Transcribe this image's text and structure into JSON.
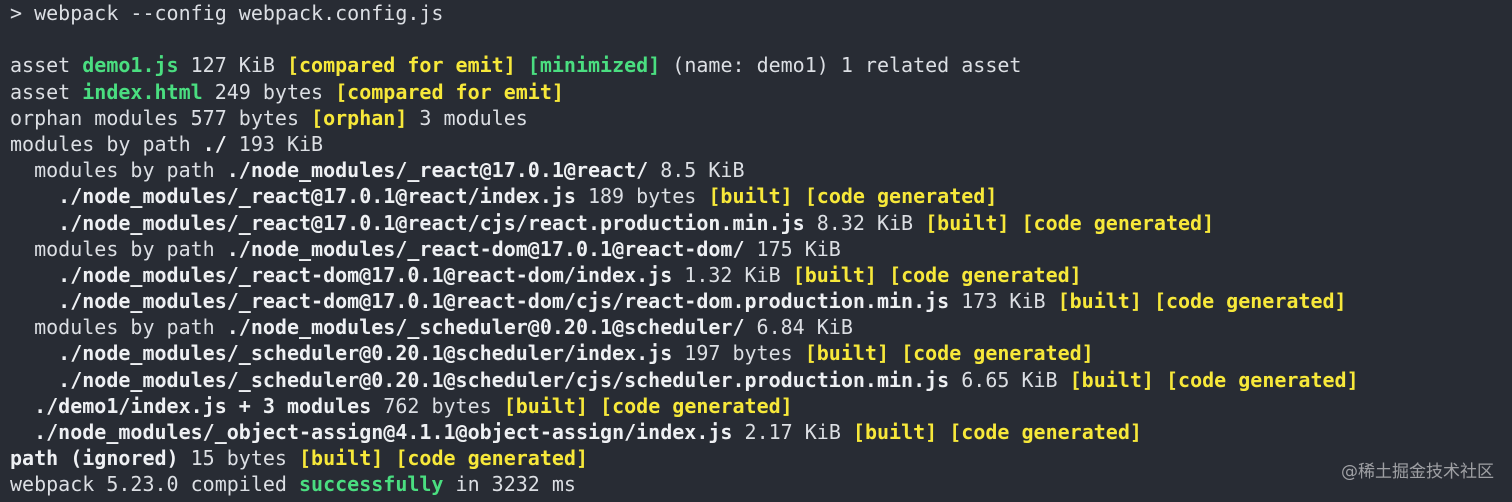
{
  "terminal": {
    "lines": [
      [
        {
          "t": "> webpack --config webpack.config.js",
          "s": "normal"
        }
      ],
      [
        {
          "t": "",
          "s": "normal"
        }
      ],
      [
        {
          "t": "asset ",
          "s": "normal"
        },
        {
          "t": "demo1.js",
          "s": "green"
        },
        {
          "t": " 127 KiB ",
          "s": "normal"
        },
        {
          "t": "[compared for emit]",
          "s": "yellow"
        },
        {
          "t": " ",
          "s": "normal"
        },
        {
          "t": "[minimized]",
          "s": "green"
        },
        {
          "t": " (name: demo1) 1 related asset",
          "s": "normal"
        }
      ],
      [
        {
          "t": "asset ",
          "s": "normal"
        },
        {
          "t": "index.html",
          "s": "green"
        },
        {
          "t": " 249 bytes ",
          "s": "normal"
        },
        {
          "t": "[compared for emit]",
          "s": "yellow"
        }
      ],
      [
        {
          "t": "orphan modules 577 bytes ",
          "s": "normal"
        },
        {
          "t": "[orphan]",
          "s": "yellow"
        },
        {
          "t": " 3 modules",
          "s": "normal"
        }
      ],
      [
        {
          "t": "modules by path ",
          "s": "normal"
        },
        {
          "t": "./",
          "s": "bold"
        },
        {
          "t": " 193 KiB",
          "s": "normal"
        }
      ],
      [
        {
          "t": "  modules by path ",
          "s": "normal"
        },
        {
          "t": "./node_modules/_react@17.0.1@react/",
          "s": "bold"
        },
        {
          "t": " 8.5 KiB",
          "s": "normal"
        }
      ],
      [
        {
          "t": "    ",
          "s": "normal"
        },
        {
          "t": "./node_modules/_react@17.0.1@react/index.js",
          "s": "bold"
        },
        {
          "t": " 189 bytes ",
          "s": "normal"
        },
        {
          "t": "[built]",
          "s": "yellow"
        },
        {
          "t": " ",
          "s": "normal"
        },
        {
          "t": "[code generated]",
          "s": "yellow"
        }
      ],
      [
        {
          "t": "    ",
          "s": "normal"
        },
        {
          "t": "./node_modules/_react@17.0.1@react/cjs/react.production.min.js",
          "s": "bold"
        },
        {
          "t": " 8.32 KiB ",
          "s": "normal"
        },
        {
          "t": "[built]",
          "s": "yellow"
        },
        {
          "t": " ",
          "s": "normal"
        },
        {
          "t": "[code generated]",
          "s": "yellow"
        }
      ],
      [
        {
          "t": "  modules by path ",
          "s": "normal"
        },
        {
          "t": "./node_modules/_react-dom@17.0.1@react-dom/",
          "s": "bold"
        },
        {
          "t": " 175 KiB",
          "s": "normal"
        }
      ],
      [
        {
          "t": "    ",
          "s": "normal"
        },
        {
          "t": "./node_modules/_react-dom@17.0.1@react-dom/index.js",
          "s": "bold"
        },
        {
          "t": " 1.32 KiB ",
          "s": "normal"
        },
        {
          "t": "[built]",
          "s": "yellow"
        },
        {
          "t": " ",
          "s": "normal"
        },
        {
          "t": "[code generated]",
          "s": "yellow"
        }
      ],
      [
        {
          "t": "    ",
          "s": "normal"
        },
        {
          "t": "./node_modules/_react-dom@17.0.1@react-dom/cjs/react-dom.production.min.js",
          "s": "bold"
        },
        {
          "t": " 173 KiB ",
          "s": "normal"
        },
        {
          "t": "[built]",
          "s": "yellow"
        },
        {
          "t": " ",
          "s": "normal"
        },
        {
          "t": "[code generated]",
          "s": "yellow"
        }
      ],
      [
        {
          "t": "  modules by path ",
          "s": "normal"
        },
        {
          "t": "./node_modules/_scheduler@0.20.1@scheduler/",
          "s": "bold"
        },
        {
          "t": " 6.84 KiB",
          "s": "normal"
        }
      ],
      [
        {
          "t": "    ",
          "s": "normal"
        },
        {
          "t": "./node_modules/_scheduler@0.20.1@scheduler/index.js",
          "s": "bold"
        },
        {
          "t": " 197 bytes ",
          "s": "normal"
        },
        {
          "t": "[built]",
          "s": "yellow"
        },
        {
          "t": " ",
          "s": "normal"
        },
        {
          "t": "[code generated]",
          "s": "yellow"
        }
      ],
      [
        {
          "t": "    ",
          "s": "normal"
        },
        {
          "t": "./node_modules/_scheduler@0.20.1@scheduler/cjs/scheduler.production.min.js",
          "s": "bold"
        },
        {
          "t": " 6.65 KiB ",
          "s": "normal"
        },
        {
          "t": "[built]",
          "s": "yellow"
        },
        {
          "t": " ",
          "s": "normal"
        },
        {
          "t": "[code generated]",
          "s": "yellow"
        }
      ],
      [
        {
          "t": "  ",
          "s": "normal"
        },
        {
          "t": "./demo1/index.js + 3 modules",
          "s": "bold"
        },
        {
          "t": " 762 bytes ",
          "s": "normal"
        },
        {
          "t": "[built]",
          "s": "yellow"
        },
        {
          "t": " ",
          "s": "normal"
        },
        {
          "t": "[code generated]",
          "s": "yellow"
        }
      ],
      [
        {
          "t": "  ",
          "s": "normal"
        },
        {
          "t": "./node_modules/_object-assign@4.1.1@object-assign/index.js",
          "s": "bold"
        },
        {
          "t": " 2.17 KiB ",
          "s": "normal"
        },
        {
          "t": "[built]",
          "s": "yellow"
        },
        {
          "t": " ",
          "s": "normal"
        },
        {
          "t": "[code generated]",
          "s": "yellow"
        }
      ],
      [
        {
          "t": "path (ignored)",
          "s": "bold"
        },
        {
          "t": " 15 bytes ",
          "s": "normal"
        },
        {
          "t": "[built]",
          "s": "yellow"
        },
        {
          "t": " ",
          "s": "normal"
        },
        {
          "t": "[code generated]",
          "s": "yellow"
        }
      ],
      [
        {
          "t": "webpack 5.23.0 compiled ",
          "s": "normal"
        },
        {
          "t": "successfully",
          "s": "green"
        },
        {
          "t": " in 3232 ms",
          "s": "normal"
        }
      ]
    ]
  },
  "watermark": {
    "text": "@稀土掘金技术社区"
  },
  "colors": {
    "background": "#282c34",
    "text": "#dcdfe4",
    "green": "#4ade80",
    "yellow": "#f7e83a"
  }
}
